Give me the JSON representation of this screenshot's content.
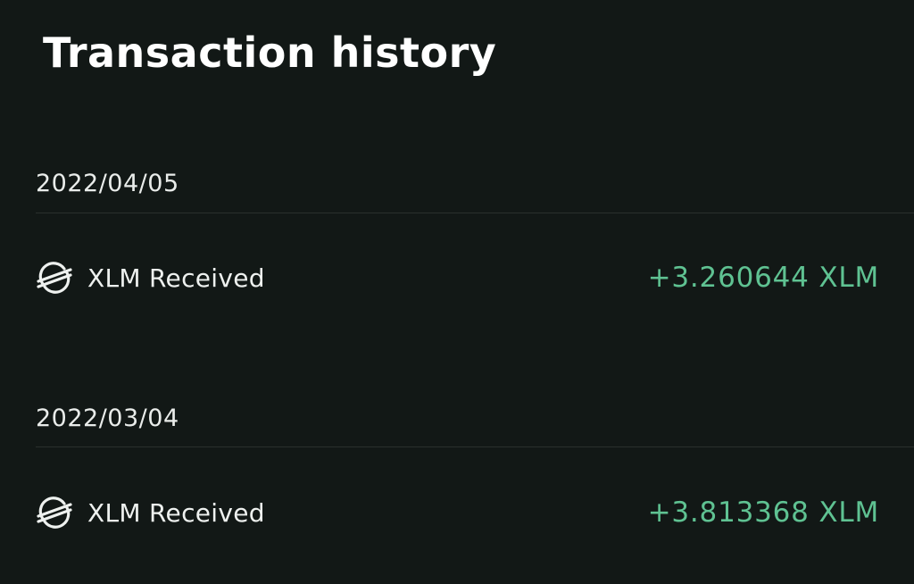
{
  "header": {
    "title": "Transaction history"
  },
  "colors": {
    "background": "#121816",
    "amount_positive": "#5fc292",
    "text": "#eef1ef"
  },
  "transactions": [
    {
      "date": "2022/04/05",
      "icon": "stellar-icon",
      "label": "XLM Received",
      "amount": "+3.260644 XLM"
    },
    {
      "date": "2022/03/04",
      "icon": "stellar-icon",
      "label": "XLM Received",
      "amount": "+3.813368 XLM"
    }
  ]
}
